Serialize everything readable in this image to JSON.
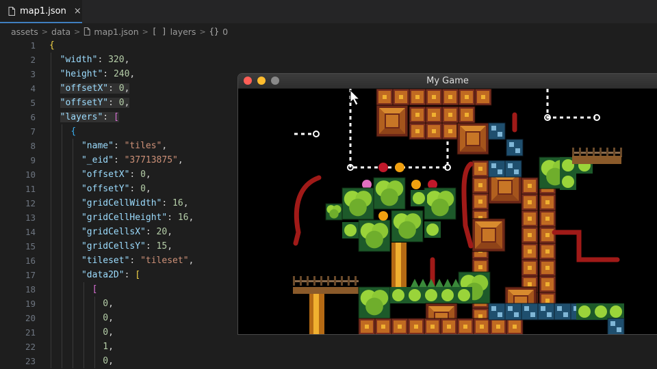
{
  "tab": {
    "filename": "map1.json",
    "close_glyph": "×",
    "icon": "file-icon"
  },
  "breadcrumbs": {
    "items": [
      "assets",
      "data",
      "map1.json",
      "layers",
      "0"
    ],
    "array_glyph": "[ ]",
    "object_glyph": "{}",
    "separator": ">"
  },
  "line_numbers": [
    "1",
    "2",
    "3",
    "4",
    "5",
    "6",
    "7",
    "8",
    "9",
    "10",
    "11",
    "12",
    "13",
    "14",
    "15",
    "16",
    "17",
    "18",
    "19",
    "20",
    "21",
    "22",
    "23"
  ],
  "code": {
    "open_brace": "{",
    "width_key": "\"width\"",
    "width_val": "320",
    "height_key": "\"height\"",
    "height_val": "240",
    "offsetX_key": "\"offsetX\"",
    "offsetX_val": "0",
    "offsetY_key": "\"offsetY\"",
    "offsetY_val": "0",
    "layers_key": "\"layers\"",
    "layers_open": "[",
    "layer_open": "{",
    "name_key": "\"name\"",
    "name_val": "\"tiles\"",
    "eid_key": "\"_eid\"",
    "eid_val": "\"37713875\"",
    "l_offsetX_key": "\"offsetX\"",
    "l_offsetX_val": "0",
    "l_offsetY_key": "\"offsetY\"",
    "l_offsetY_val": "0",
    "gcw_key": "\"gridCellWidth\"",
    "gcw_val": "16",
    "gch_key": "\"gridCellHeight\"",
    "gch_val": "16",
    "gcx_key": "\"gridCellsX\"",
    "gcx_val": "20",
    "gcy_key": "\"gridCellsY\"",
    "gcy_val": "15",
    "tileset_key": "\"tileset\"",
    "tileset_val": "\"tileset\"",
    "data2d_key": "\"data2D\"",
    "data2d_open": "[",
    "row_open": "[",
    "values": [
      "0",
      "0",
      "0",
      "1",
      "0"
    ]
  },
  "game_window": {
    "title": "My Game",
    "scene": "platformer-tile-map",
    "background": "#000000"
  },
  "colors": {
    "accent": "#3f7fbf",
    "key": "#9cdcfe",
    "number": "#b5cea8",
    "string": "#ce9178"
  }
}
